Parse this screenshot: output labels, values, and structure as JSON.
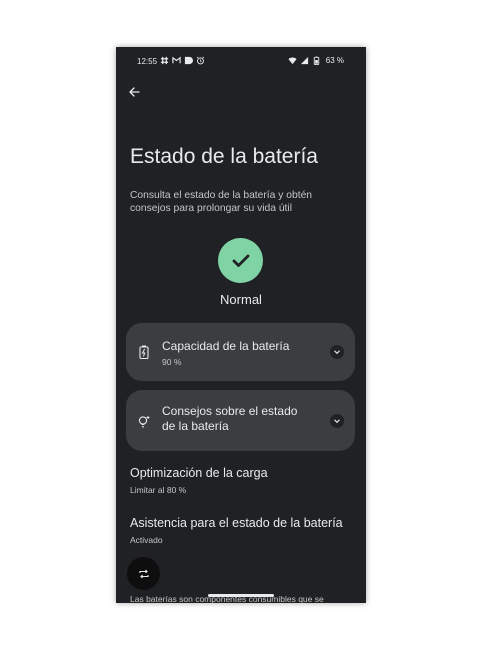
{
  "status_bar": {
    "time": "12:55",
    "battery": "63 %"
  },
  "header": {
    "back_icon": "arrow-back-icon"
  },
  "page": {
    "title": "Estado de la batería",
    "description": "Consulta el estado de la batería y obtén consejos para prolongar su vida útil",
    "status_label": "Normal",
    "status_color": "#7fd3a4"
  },
  "cards": [
    {
      "title": "Capacidad de la batería",
      "subtitle": "90 %",
      "icon": "battery-icon"
    },
    {
      "title": "Consejos sobre el estado de la batería",
      "subtitle": "",
      "icon": "lightbulb-icon"
    }
  ],
  "settings": [
    {
      "title": "Optimización de la carga",
      "subtitle": "Limitar al 80 %"
    },
    {
      "title": "Asistencia para el estado de la batería",
      "subtitle": "Activado"
    }
  ],
  "footer": {
    "text": "Las baterías son componentes consumibles que se"
  },
  "colors": {
    "background": "#202124",
    "card": "#3c3d40",
    "text": "#e8eaed",
    "accent_green": "#7fd3a4"
  }
}
